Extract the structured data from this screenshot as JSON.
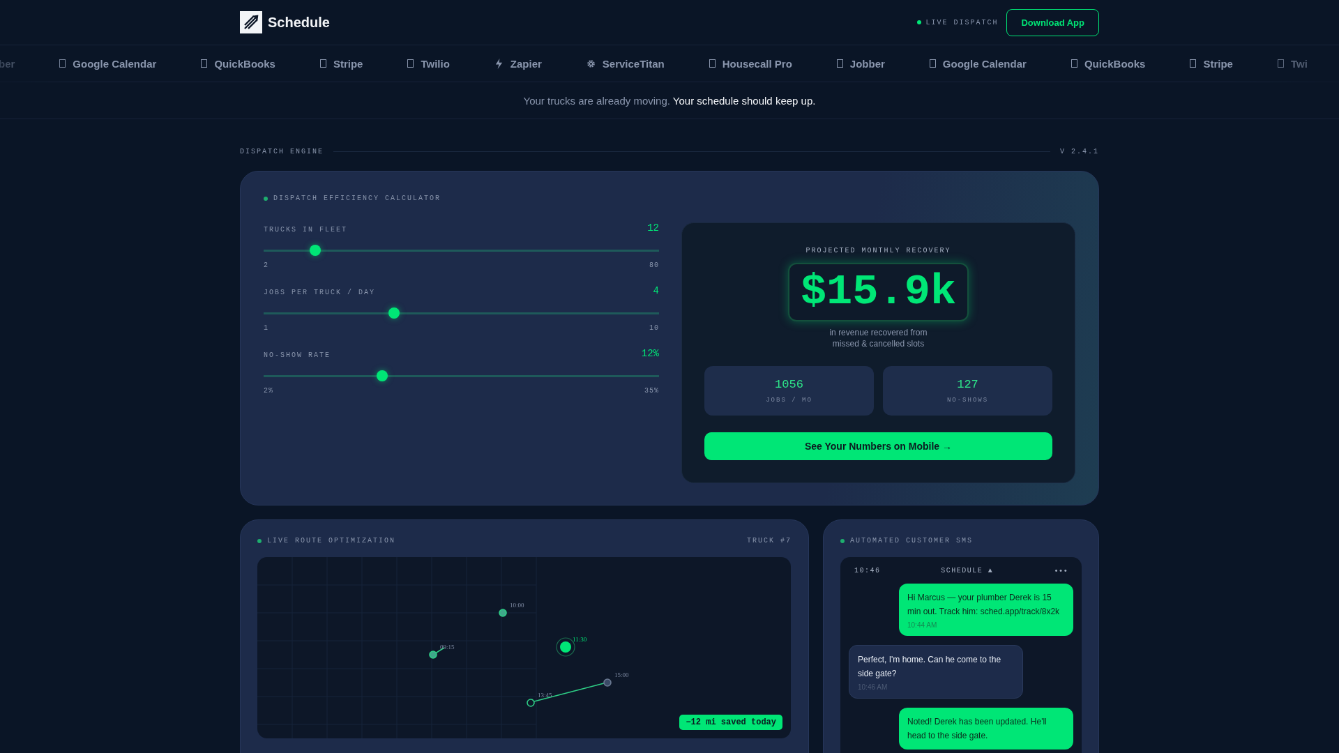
{
  "header": {
    "brand": "Schedule",
    "status": "LIVE DISPATCH",
    "live": true,
    "download_button": "Download App"
  },
  "integrations": [
    {
      "name": "ber",
      "kind": "bare"
    },
    {
      "name": "Google Calendar",
      "kind": "glyph"
    },
    {
      "name": "QuickBooks",
      "kind": "glyph"
    },
    {
      "name": "Stripe",
      "kind": "glyph"
    },
    {
      "name": "Twilio",
      "kind": "glyph"
    },
    {
      "name": "Zapier",
      "kind": "bolt"
    },
    {
      "name": "ServiceTitan",
      "kind": "gear"
    },
    {
      "name": "Housecall Pro",
      "kind": "glyph"
    },
    {
      "name": "Jobber",
      "kind": "glyph"
    },
    {
      "name": "Google Calendar",
      "kind": "glyph"
    },
    {
      "name": "QuickBooks",
      "kind": "glyph"
    },
    {
      "name": "Stripe",
      "kind": "glyph"
    },
    {
      "name": "Twi",
      "kind": "glyph"
    }
  ],
  "tagline": {
    "lead": "Your trucks are already moving.",
    "emphasis": "Your schedule should keep up."
  },
  "section": {
    "title": "DISPATCH ENGINE",
    "version": "V 2.4.1"
  },
  "calculator": {
    "title": "DISPATCH EFFICIENCY CALCULATOR",
    "sliders": [
      {
        "label": "TRUCKS IN FLEET",
        "value": "12",
        "level": 0.13,
        "min": "2",
        "max": "80"
      },
      {
        "label": "JOBS PER TRUCK / DAY",
        "value": "4",
        "level": 0.33,
        "min": "1",
        "max": "10"
      },
      {
        "label": "NO-SHOW RATE",
        "value": "12%",
        "level": 0.3,
        "min": "2%",
        "max": "35%"
      }
    ],
    "result": {
      "label": "PROJECTED MONTHLY RECOVERY",
      "amount": "$15.9k",
      "caption": "in revenue recovered from missed & cancelled slots",
      "stats": [
        {
          "value": "1056",
          "label": "JOBS / MO"
        },
        {
          "value": "127",
          "label": "NO-SHOWS"
        }
      ],
      "cta": "See Your Numbers on Mobile →"
    }
  },
  "route": {
    "title": "LIVE ROUTE OPTIMIZATION",
    "truck": "TRUCK #7",
    "stops": [
      {
        "time": "09:15",
        "kind": "done"
      },
      {
        "time": "10:00",
        "kind": "done"
      },
      {
        "time": "11:30",
        "kind": "current"
      },
      {
        "time": "13:45",
        "kind": "next"
      },
      {
        "time": "15:00",
        "kind": "pending"
      }
    ],
    "savings": "−12 mi saved today"
  },
  "sms": {
    "title": "AUTOMATED CUSTOMER SMS",
    "clock": "10:46",
    "app": "SCHEDULE ▲",
    "menu": "•••",
    "messages": [
      {
        "kind": "outgoing",
        "text": "Hi Marcus — your plumber Derek is 15 min out. Track him: sched.app/track/8x2k",
        "time": "10:44 AM"
      },
      {
        "kind": "incoming",
        "text": "Perfect, I'm home. Can he come to the side gate?",
        "time": "10:46 AM"
      },
      {
        "kind": "outgoing",
        "text": "Noted! Derek has been updated. He'll head to the side gate."
      }
    ]
  }
}
